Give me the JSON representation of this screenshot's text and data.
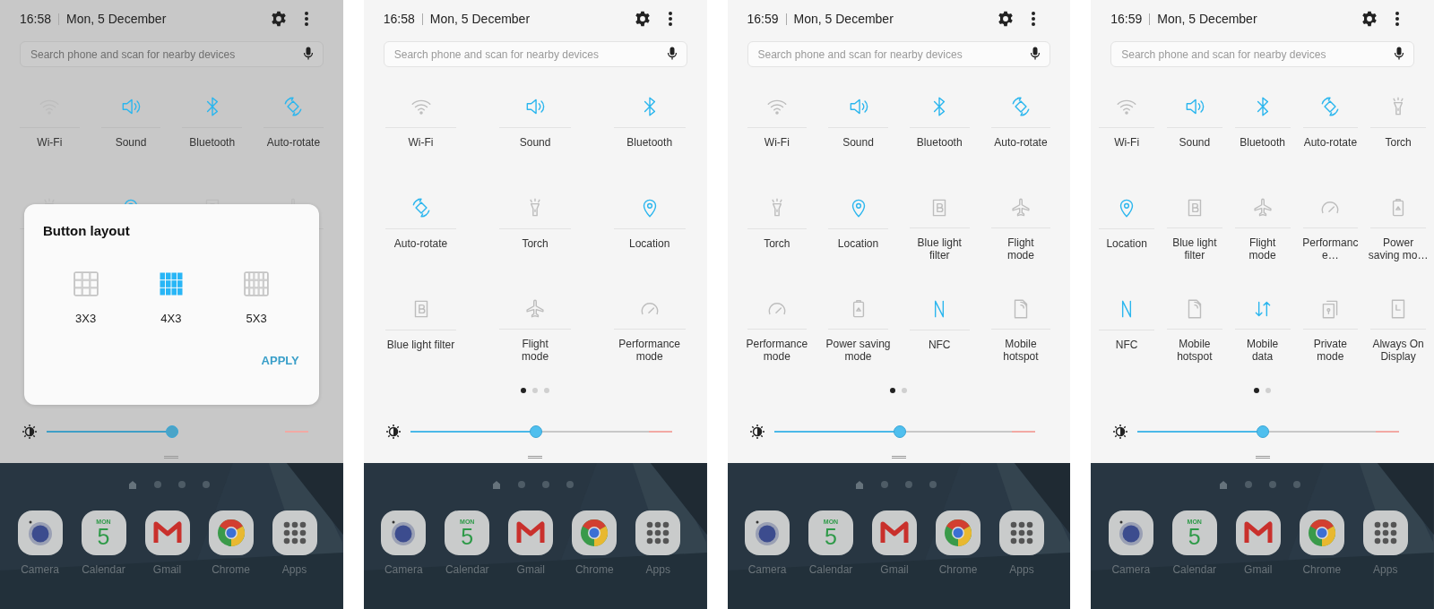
{
  "screens": [
    {
      "time": "16:58",
      "date": "Mon, 5 December",
      "search": {
        "placeholder": "Search phone and scan for nearby devices"
      },
      "dimmed": true,
      "tile_rows": [
        [
          {
            "kind": "wifi",
            "label": "Wi-Fi",
            "on": false
          },
          {
            "kind": "sound",
            "label": "Sound",
            "on": true
          },
          {
            "kind": "bluetooth",
            "label": "Bluetooth",
            "on": true
          },
          {
            "kind": "rotate",
            "label": "Auto-rotate",
            "on": true
          }
        ],
        [
          {
            "kind": "torch",
            "on": false
          },
          {
            "kind": "location",
            "on": true
          },
          {
            "kind": "bluelight",
            "on": false
          },
          {
            "kind": "flight",
            "on": false
          }
        ]
      ],
      "brightness": {
        "level": 0.48
      },
      "dialog": {
        "title": "Button layout",
        "options": [
          {
            "label": "3X3",
            "selected": false
          },
          {
            "label": "4X3",
            "selected": true
          },
          {
            "label": "5X3",
            "selected": false
          }
        ],
        "button": "APPLY"
      },
      "dock": [
        {
          "kind": "camera",
          "label": "Camera"
        },
        {
          "kind": "calendar",
          "label": "Calendar",
          "month": "MON",
          "day": "5"
        },
        {
          "kind": "gmail",
          "label": "Gmail"
        },
        {
          "kind": "chrome",
          "label": "Chrome"
        },
        {
          "kind": "apps",
          "label": "Apps"
        }
      ]
    },
    {
      "time": "16:58",
      "date": "Mon, 5 December",
      "search": {
        "placeholder": "Search phone and scan for nearby devices"
      },
      "dimmed": false,
      "tile_rows": [
        [
          {
            "kind": "wifi",
            "label": "Wi-Fi",
            "on": false
          },
          {
            "kind": "sound",
            "label": "Sound",
            "on": true
          },
          {
            "kind": "bluetooth",
            "label": "Bluetooth",
            "on": true
          }
        ],
        [
          {
            "kind": "rotate",
            "label": "Auto-rotate",
            "on": true
          },
          {
            "kind": "torch",
            "label": "Torch",
            "on": false
          },
          {
            "kind": "location",
            "label": "Location",
            "on": true
          }
        ],
        [
          {
            "kind": "bluelight",
            "label": "Blue light filter",
            "on": false
          },
          {
            "kind": "flight",
            "label": "Flight\nmode",
            "on": false
          },
          {
            "kind": "performance",
            "label": "Performance\nmode",
            "on": false
          }
        ]
      ],
      "pages": [
        {
          "selected": true
        },
        {
          "selected": false
        },
        {
          "selected": false
        }
      ],
      "brightness": {
        "level": 0.48
      },
      "dock": [
        {
          "kind": "camera",
          "label": "Camera"
        },
        {
          "kind": "calendar",
          "label": "Calendar",
          "month": "MON",
          "day": "5"
        },
        {
          "kind": "gmail",
          "label": "Gmail"
        },
        {
          "kind": "chrome",
          "label": "Chrome"
        },
        {
          "kind": "apps",
          "label": "Apps"
        }
      ]
    },
    {
      "time": "16:59",
      "date": "Mon, 5 December",
      "search": {
        "placeholder": "Search phone and scan for nearby devices"
      },
      "dimmed": false,
      "tile_rows": [
        [
          {
            "kind": "wifi",
            "label": "Wi-Fi",
            "on": false
          },
          {
            "kind": "sound",
            "label": "Sound",
            "on": true
          },
          {
            "kind": "bluetooth",
            "label": "Bluetooth",
            "on": true
          },
          {
            "kind": "rotate",
            "label": "Auto-rotate",
            "on": true
          }
        ],
        [
          {
            "kind": "torch",
            "label": "Torch",
            "on": false
          },
          {
            "kind": "location",
            "label": "Location",
            "on": true
          },
          {
            "kind": "bluelight",
            "label": "Blue light\nfilter",
            "on": false
          },
          {
            "kind": "flight",
            "label": "Flight\nmode",
            "on": false
          }
        ],
        [
          {
            "kind": "performance",
            "label": "Performance\nmode",
            "on": false
          },
          {
            "kind": "power",
            "label": "Power saving\nmode",
            "on": false
          },
          {
            "kind": "nfc",
            "label": "NFC",
            "on": true
          },
          {
            "kind": "hotspot",
            "label": "Mobile\nhotspot",
            "on": false
          }
        ]
      ],
      "pages": [
        {
          "selected": true
        },
        {
          "selected": false
        }
      ],
      "brightness": {
        "level": 0.48
      },
      "dock": [
        {
          "kind": "camera",
          "label": "Camera"
        },
        {
          "kind": "calendar",
          "label": "Calendar",
          "month": "MON",
          "day": "5"
        },
        {
          "kind": "gmail",
          "label": "Gmail"
        },
        {
          "kind": "chrome",
          "label": "Chrome"
        },
        {
          "kind": "apps",
          "label": "Apps"
        }
      ]
    },
    {
      "time": "16:59",
      "date": "Mon, 5 December",
      "search": {
        "placeholder": "Search phone and scan for nearby devices"
      },
      "dimmed": false,
      "tile_rows": [
        [
          {
            "kind": "wifi",
            "label": "Wi-Fi",
            "on": false
          },
          {
            "kind": "sound",
            "label": "Sound",
            "on": true
          },
          {
            "kind": "bluetooth",
            "label": "Bluetooth",
            "on": true
          },
          {
            "kind": "rotate",
            "label": "Auto-rotate",
            "on": true
          },
          {
            "kind": "torch",
            "label": "Torch",
            "on": false
          }
        ],
        [
          {
            "kind": "location",
            "label": "Location",
            "on": true
          },
          {
            "kind": "bluelight",
            "label": "Blue light\nfilter",
            "on": false
          },
          {
            "kind": "flight",
            "label": "Flight\nmode",
            "on": false
          },
          {
            "kind": "performance",
            "label": "Performanc\ne…",
            "on": false
          },
          {
            "kind": "power",
            "label": "Power\nsaving mo…",
            "on": false
          }
        ],
        [
          {
            "kind": "nfc",
            "label": "NFC",
            "on": true
          },
          {
            "kind": "hotspot",
            "label": "Mobile\nhotspot",
            "on": false
          },
          {
            "kind": "data",
            "label": "Mobile\ndata",
            "on": true
          },
          {
            "kind": "private",
            "label": "Private\nmode",
            "on": false
          },
          {
            "kind": "aod",
            "label": "Always On\nDisplay",
            "on": false
          }
        ]
      ],
      "pages": [
        {
          "selected": true
        },
        {
          "selected": false
        }
      ],
      "brightness": {
        "level": 0.48
      },
      "dock": [
        {
          "kind": "camera",
          "label": "Camera"
        },
        {
          "kind": "calendar",
          "label": "Calendar",
          "month": "MON",
          "day": "5"
        },
        {
          "kind": "gmail",
          "label": "Gmail"
        },
        {
          "kind": "chrome",
          "label": "Chrome"
        },
        {
          "kind": "apps",
          "label": "Apps"
        }
      ]
    }
  ]
}
